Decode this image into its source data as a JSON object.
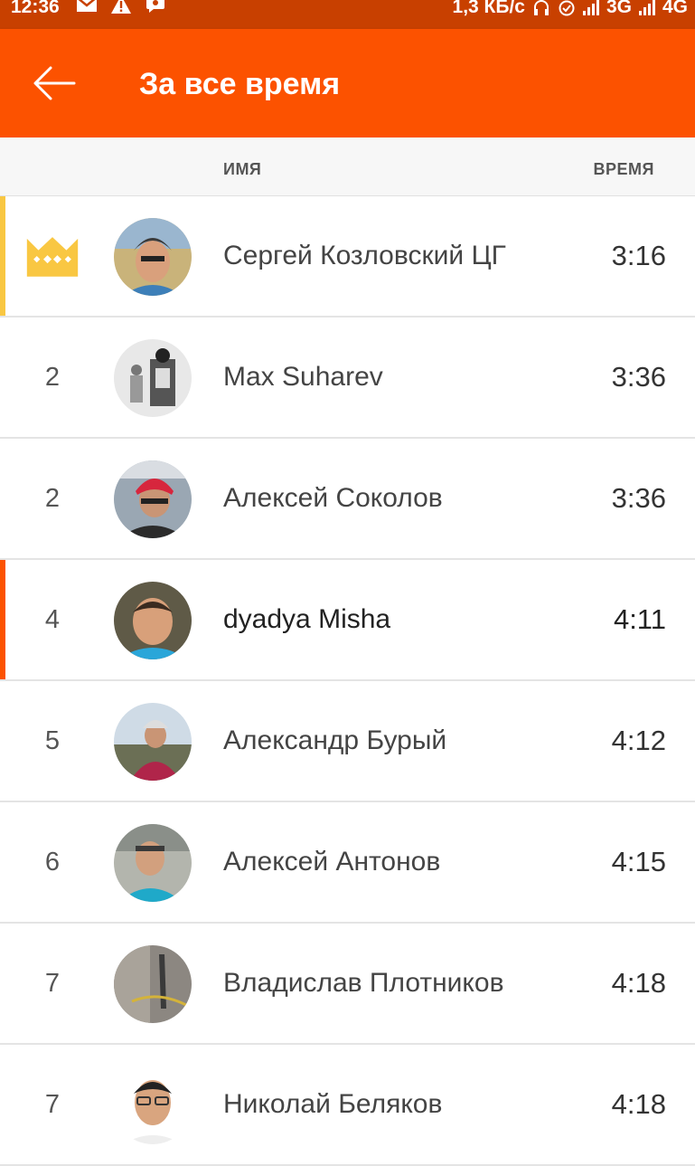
{
  "status_bar": {
    "time": "12:36",
    "net_speed": "1,3 КБ/с",
    "net1": "3G",
    "net2": "4G",
    "icons": [
      "mail-icon",
      "warning-icon",
      "notification-icon",
      "headphones-icon",
      "alarm-icon",
      "signal-icon"
    ]
  },
  "app_bar": {
    "title": "За все время",
    "back_icon": "arrow-left-icon"
  },
  "columns": {
    "name": "ИМЯ",
    "time": "ВРЕМЯ"
  },
  "colors": {
    "brand": "#fc5200",
    "status_bar": "#c84000",
    "leader_accent": "#f9c742",
    "current_user_accent": "#fc5200"
  },
  "rows": [
    {
      "rank": "",
      "rank_icon": "crown-icon",
      "name": "Сергей Козловский ЦГ",
      "time": "3:16"
    },
    {
      "rank": "2",
      "name": "Max Suharev",
      "time": "3:36"
    },
    {
      "rank": "2",
      "name": "Алексей Соколов",
      "time": "3:36"
    },
    {
      "rank": "4",
      "name": "dyadya Misha",
      "time": "4:11"
    },
    {
      "rank": "5",
      "name": "Александр Бурый",
      "time": "4:12"
    },
    {
      "rank": "6",
      "name": "Алексей Антонов",
      "time": "4:15"
    },
    {
      "rank": "7",
      "name": "Владислав Плотников",
      "time": "4:18"
    },
    {
      "rank": "7",
      "name": "Николай Беляков",
      "time": "4:18"
    }
  ]
}
